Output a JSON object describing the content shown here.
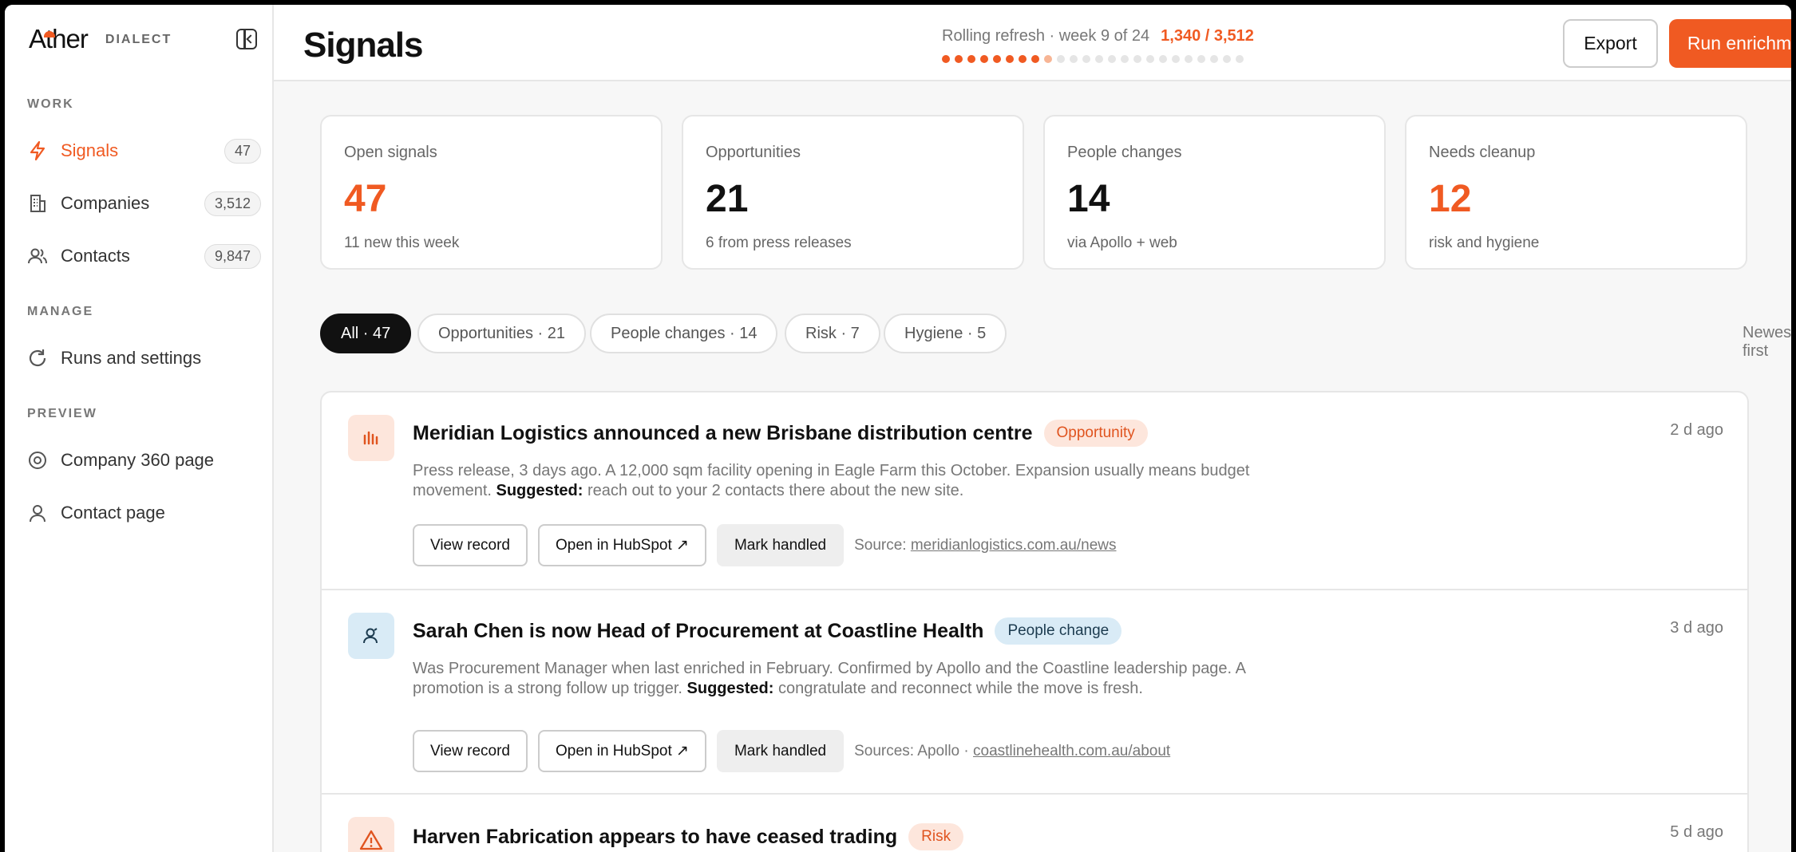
{
  "brand": {
    "name_a": "A",
    "name_rest": "ther",
    "product": "DIALECT"
  },
  "sidebar": {
    "sections": {
      "work": "WORK",
      "manage": "MANAGE",
      "preview": "PREVIEW"
    },
    "items": [
      {
        "label": "Signals",
        "count": "47",
        "icon": "lightning-icon",
        "active": true
      },
      {
        "label": "Companies",
        "count": "3,512",
        "icon": "building-icon"
      },
      {
        "label": "Contacts",
        "count": "9,847",
        "icon": "users-icon"
      },
      {
        "label": "Runs and settings",
        "icon": "refresh-icon"
      },
      {
        "label": "Company 360 page",
        "icon": "target-icon"
      },
      {
        "label": "Contact page",
        "icon": "user-icon"
      }
    ]
  },
  "header": {
    "title": "Signals",
    "refresh_text": "Rolling refresh · week 9 of 24",
    "refresh_ratio": "1,340 / 3,512",
    "progress": {
      "weeks_total": 24,
      "weeks_done": 8,
      "current_week": 9
    },
    "export_label": "Export",
    "run_label": "Run enrichment"
  },
  "stats": [
    {
      "label": "Open signals",
      "value": "47",
      "sub": "11 new this week"
    },
    {
      "label": "Opportunities",
      "value": "21",
      "sub": "6 from press releases"
    },
    {
      "label": "People changes",
      "value": "14",
      "sub": "via Apollo + web"
    },
    {
      "label": "Needs cleanup",
      "value": "12",
      "sub": "risk and hygiene"
    }
  ],
  "filters": [
    {
      "label": "All · 47",
      "active": true
    },
    {
      "label": "Opportunities · 21"
    },
    {
      "label": "People changes · 14"
    },
    {
      "label": "Risk · 7"
    },
    {
      "label": "Hygiene · 5"
    }
  ],
  "sort_label": "Newest first",
  "signals": [
    {
      "title": "Meridian Logistics announced a new Brisbane distribution centre",
      "tag": "Opportunity",
      "age": "2 d ago",
      "desc_pre": "Press release, 3 days ago. A 12,000 sqm facility opening in Eagle Farm this October. Expansion usually means budget movement.",
      "suggested_label": "Suggested:",
      "desc_post": "reach out to your 2 contacts there about the new site.",
      "view_label": "View record",
      "hubspot_label": "Open in HubSpot ↗",
      "handled_label": "Mark handled",
      "source_prefix": "Source:",
      "source_link": "meridianlogistics.com.au/news"
    },
    {
      "title": "Sarah Chen is now Head of Procurement at Coastline Health",
      "tag": "People change",
      "age": "3 d ago",
      "desc_pre": "Was Procurement Manager when last enriched in February. Confirmed by Apollo and the Coastline leadership page. A promotion is a strong follow up trigger.",
      "suggested_label": "Suggested:",
      "desc_post": "congratulate and reconnect while the move is fresh.",
      "view_label": "View record",
      "hubspot_label": "Open in HubSpot ↗",
      "handled_label": "Mark handled",
      "source_prefix": "Sources: Apollo ·",
      "source_link": "coastlinehealth.com.au/about"
    },
    {
      "title": "Harven Fabrication appears to have ceased trading",
      "tag": "Risk",
      "age": "5 d ago"
    }
  ],
  "colors": {
    "accent": "#f05a22",
    "opportunity_bg": "#fde6dc",
    "people_bg": "#d9ebf6"
  }
}
